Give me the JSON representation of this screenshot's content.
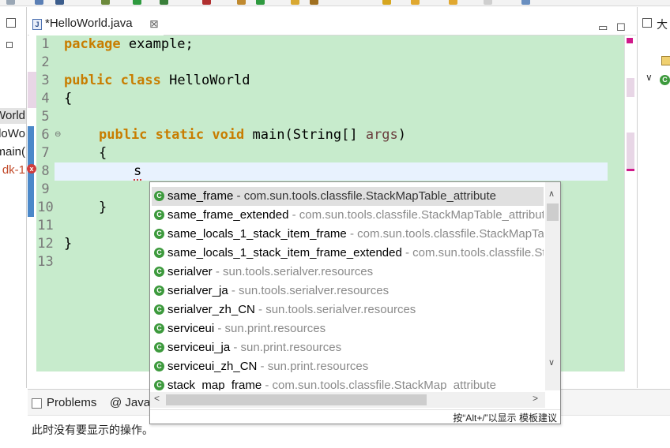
{
  "editor": {
    "tab_title": "*HelloWorld.java",
    "close_glyph": "⊠",
    "minimize_glyph": "▭",
    "maximize_glyph": "☐",
    "line_numbers": [
      "1",
      "2",
      "3",
      "4",
      "5",
      "6",
      "7",
      "8",
      "9",
      "10",
      "11",
      "12",
      "13"
    ],
    "code": {
      "l1_kw": "package",
      "l1_rest": " example;",
      "l3_kw1": "public",
      "l3_kw2": "class",
      "l3_rest": " HelloWorld",
      "l4": "{",
      "l6_kw1": "public",
      "l6_kw2": "static",
      "l6_kw3": "void",
      "l6_rest": " main(String[] ",
      "l6_param": "args",
      "l6_end": ")",
      "l7": "{",
      "l8": "s",
      "l10": "}",
      "l12": "}"
    }
  },
  "left_panel": {
    "items": [
      "World",
      "loWo",
      "main(",
      "dk-1"
    ]
  },
  "right_panel": {
    "title": "大"
  },
  "completion_popup": {
    "items": [
      {
        "name": "same_frame",
        "pkg": " - com.sun.tools.classfile.StackMapTable_attribute",
        "selected": true
      },
      {
        "name": "same_frame_extended",
        "pkg": " - com.sun.tools.classfile.StackMapTable_attribute"
      },
      {
        "name": "same_locals_1_stack_item_frame",
        "pkg": " - com.sun.tools.classfile.StackMapTable_attribute"
      },
      {
        "name": "same_locals_1_stack_item_frame_extended",
        "pkg": " - com.sun.tools.classfile.StackMapTable_attribute"
      },
      {
        "name": "serialver",
        "pkg": " - sun.tools.serialver.resources"
      },
      {
        "name": "serialver_ja",
        "pkg": " - sun.tools.serialver.resources"
      },
      {
        "name": "serialver_zh_CN",
        "pkg": " - sun.tools.serialver.resources"
      },
      {
        "name": "serviceui",
        "pkg": " - sun.print.resources"
      },
      {
        "name": "serviceui_ja",
        "pkg": " - sun.print.resources"
      },
      {
        "name": "serviceui_zh_CN",
        "pkg": " - sun.print.resources"
      },
      {
        "name": "stack_map_frame",
        "pkg": " - com.sun.tools.classfile.StackMap_attribute"
      }
    ],
    "hint": "按“Alt+/”以显示 模板建议",
    "scroll_up": "∧",
    "scroll_down": "∨",
    "scroll_left": "<",
    "scroll_right": ">"
  },
  "bottom_panel": {
    "tab_problems": "Problems",
    "tab_javadoc": "@ Javad",
    "message": "此时没有要显示的操作。"
  },
  "colors": {
    "editor_bg": "#c7ebcc",
    "keyword": "#c87d00",
    "error": "#d03c3c"
  }
}
